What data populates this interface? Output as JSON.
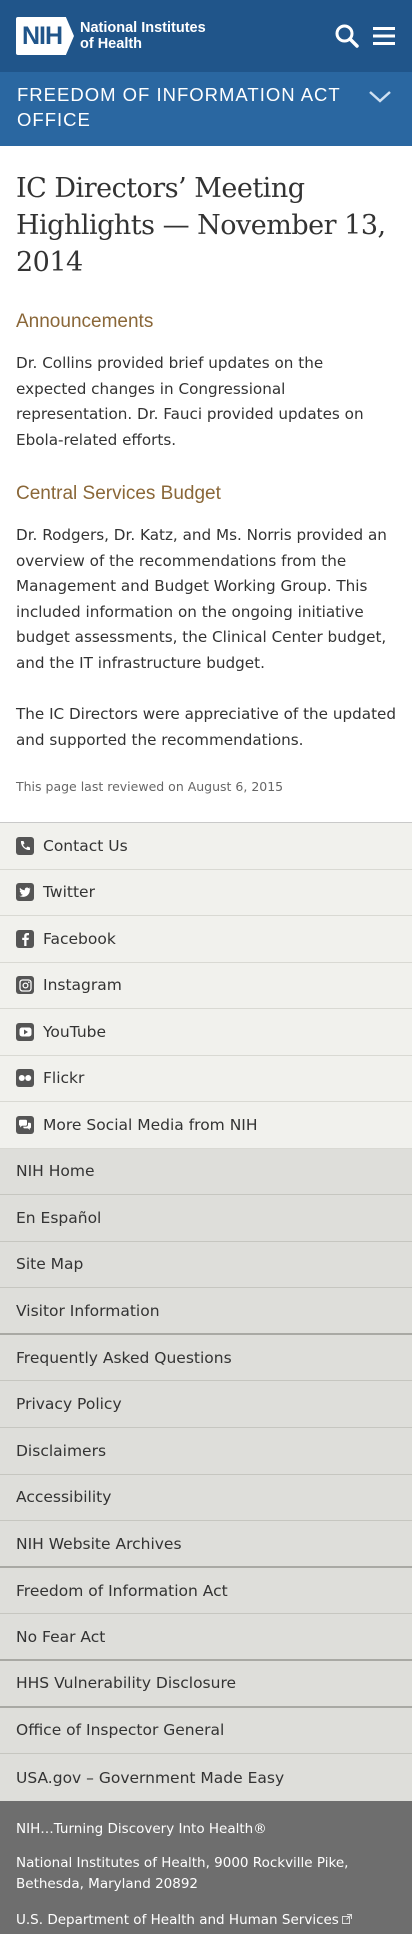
{
  "header": {
    "logo_mark": "NIH",
    "logo_line1": "National Institutes",
    "logo_line2": "of Health",
    "search_icon": "search-icon",
    "menu_icon": "hamburger-menu-icon"
  },
  "office_bar": {
    "line1": "FREEDOM OF INFORMATION ACT",
    "line2": "OFFICE",
    "chevron_icon": "chevron-down-icon"
  },
  "article": {
    "title": "IC Directors’ Meeting Highlights — November 13, 2014",
    "sections": [
      {
        "heading": "Announcements",
        "paragraphs": [
          "Dr. Collins provided brief updates on the expected changes in Congressional representation. Dr. Fauci provided updates on Ebola-related efforts."
        ]
      },
      {
        "heading": "Central Services Budget",
        "paragraphs": [
          "Dr. Rodgers, Dr. Katz, and Ms. Norris provided an overview of the recommendations from the Management and Budget Working Group. This included information on the ongoing initiative budget assessments, the Clinical Center budget, and the IT infrastructure budget.",
          "The IC Directors were appreciative of the updated and supported the recommendations."
        ]
      }
    ],
    "last_reviewed": "This page last reviewed on August 6, 2015"
  },
  "social_links": [
    {
      "label": "Contact Us",
      "icon": "phone-icon"
    },
    {
      "label": "Twitter",
      "icon": "twitter-icon"
    },
    {
      "label": "Facebook",
      "icon": "facebook-icon"
    },
    {
      "label": "Instagram",
      "icon": "instagram-icon"
    },
    {
      "label": "YouTube",
      "icon": "youtube-icon"
    },
    {
      "label": "Flickr",
      "icon": "flickr-icon"
    },
    {
      "label": "More Social Media from NIH",
      "icon": "chat-bubbles-icon"
    }
  ],
  "footer_links": [
    "NIH Home",
    "En Español",
    "Site Map",
    "Visitor Information",
    "Frequently Asked Questions",
    "Privacy Policy",
    "Disclaimers",
    "Accessibility",
    "NIH Website Archives",
    "Freedom of Information Act",
    "No Fear Act",
    "HHS Vulnerability Disclosure",
    "Office of Inspector General",
    "USA.gov – Government Made Easy"
  ],
  "footer": {
    "tagline": "NIH…Turning Discovery Into Health®",
    "address_line1": "National Institutes of Health, 9000 Rockville Pike,",
    "address_line2": "Bethesda, Maryland 20892",
    "hhs_link": "U.S. Department of Health and Human Services",
    "external_icon": "external-link-icon"
  },
  "colors": {
    "header_bg": "#20558a",
    "office_bar_bg": "#2a67a1",
    "section_heading": "#8a6738",
    "social_bg": "#f1f1ed",
    "links_bg": "#dededa",
    "footer_bg": "#6e6e6e"
  }
}
